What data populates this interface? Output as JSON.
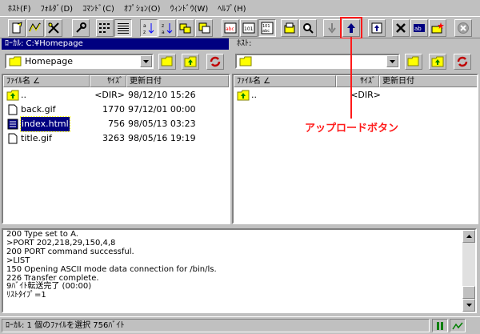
{
  "menu": [
    "ﾎｽﾄ(F)",
    "ﾌｫﾙﾀﾞ(D)",
    "ｺﾏﾝﾄﾞ(C)",
    "ｵﾌﾟｼｮﾝ(O)",
    "ｳｨﾝﾄﾞｳ(W)",
    "ﾍﾙﾌﾟ(H)"
  ],
  "toolbar": {
    "icons": [
      "connect-icon",
      "quick-connect-icon",
      "disconnect-icon",
      "settings-icon",
      "list-view-icon",
      "detail-view-icon",
      "sort-asc-icon",
      "sort-desc-icon",
      "folder-sync-icon",
      "window-icon",
      "text-mode-icon",
      "binary-mode-icon",
      "auto-mode-icon",
      "open-icon",
      "find-icon",
      "download-icon",
      "upload-icon",
      "mirror-upload-icon",
      "delete-icon",
      "rename-icon",
      "mkdir-icon",
      "stop-icon"
    ],
    "accent": "#ff1a1a"
  },
  "local": {
    "header": "ﾛｰｶﾙ: C:¥Homepage",
    "path": "Homepage",
    "columns": [
      "ﾌｧｲﾙ名 ∠",
      "ｻｲｽﾞ",
      "更新日付"
    ],
    "files": [
      {
        "name": "..",
        "size": "<DIR>",
        "date": "98/12/10 15:26",
        "type": "up",
        "selected": false
      },
      {
        "name": "back.gif",
        "size": "1770",
        "date": "97/12/01 00:00",
        "type": "file",
        "selected": false
      },
      {
        "name": "index.html",
        "size": "756",
        "date": "98/05/13 03:23",
        "type": "html",
        "selected": true
      },
      {
        "name": "title.gif",
        "size": "3263",
        "date": "98/05/16 19:19",
        "type": "file",
        "selected": false
      }
    ]
  },
  "remote": {
    "header": "ﾎｽﾄ:",
    "path": "",
    "columns": [
      "ﾌｧｲﾙ名 ∠",
      "ｻｲｽﾞ",
      "更新日付"
    ],
    "files": [
      {
        "name": "..",
        "size": "<DIR>",
        "date": "",
        "type": "up",
        "selected": false
      }
    ]
  },
  "log": [
    "200 Type set to A.",
    ">PORT 202,218,29,150,4,8",
    "200 PORT command successful.",
    ">LIST",
    "150 Opening ASCII mode data connection for /bin/ls.",
    "226 Transfer complete.",
    "9ﾊﾞｲﾄ転送完了 (00:00)",
    "ﾘｽﾄﾀｲﾌﾟ=1"
  ],
  "status": "ﾛｰｶﾙ: 1 個のﾌｧｲﾙを選択  756ﾊﾞｲﾄ",
  "annotation": "アップロードボタン",
  "colors": {
    "active_header": "#000080",
    "face": "#c0c0c0",
    "annotation": "#ff1a1a"
  }
}
